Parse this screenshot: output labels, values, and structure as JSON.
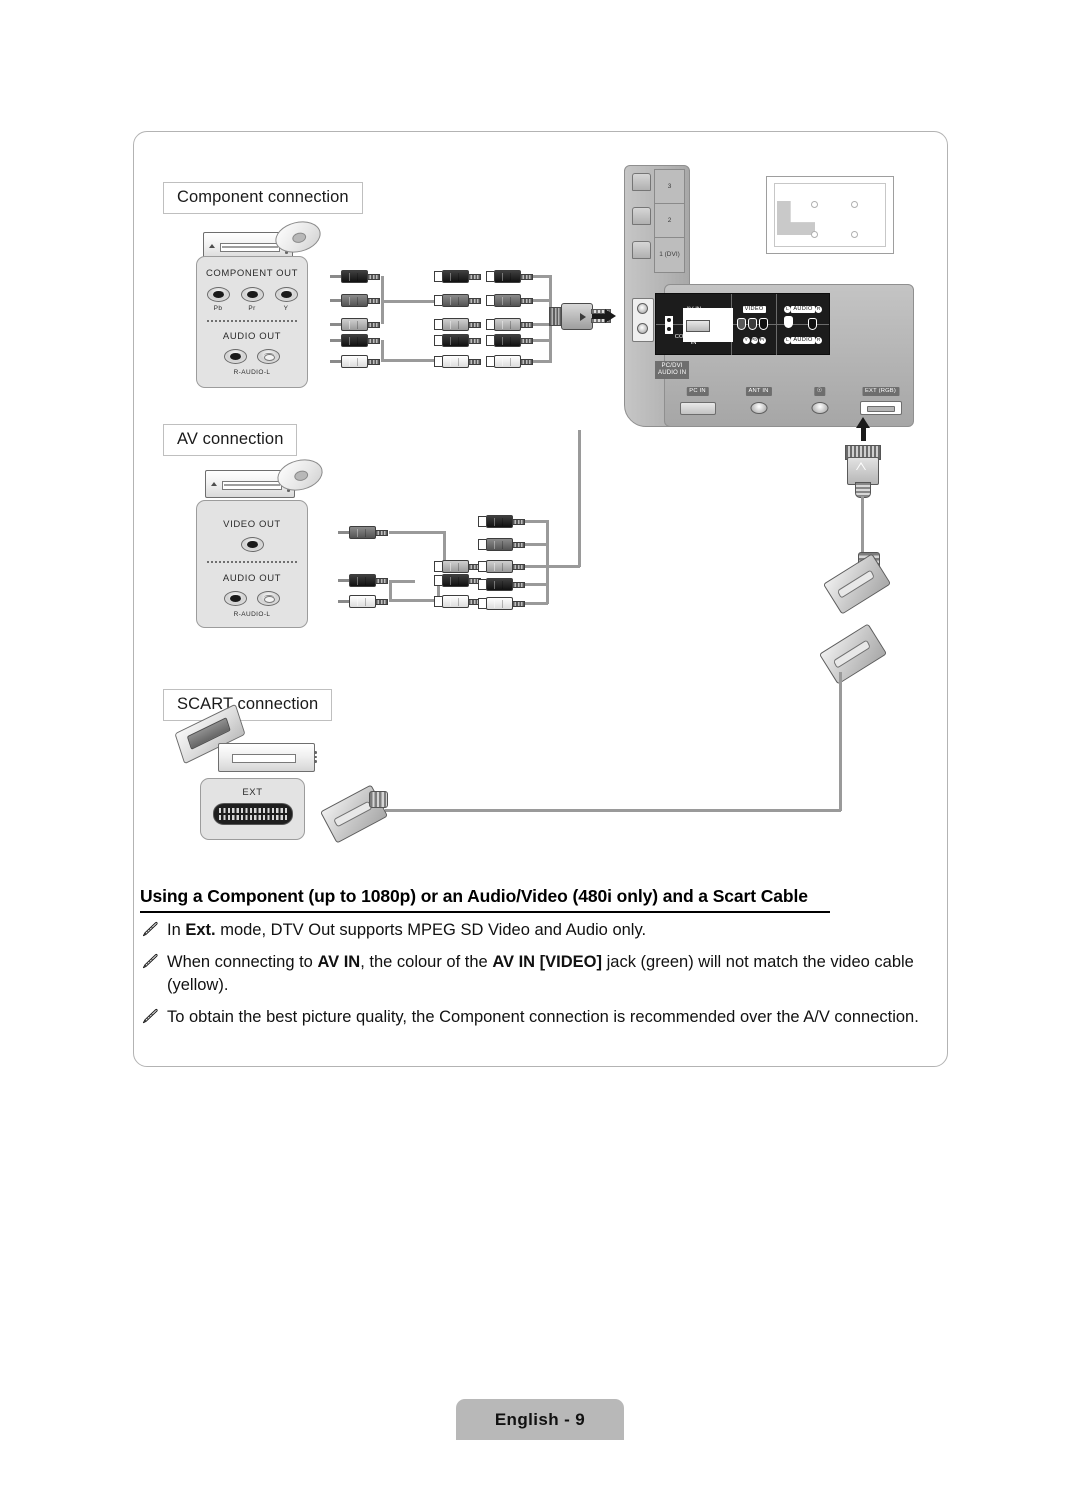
{
  "sections": [
    {
      "id": "component",
      "title": "Component connection"
    },
    {
      "id": "av",
      "title": "AV connection"
    },
    {
      "id": "scart",
      "title": "SCART connection"
    }
  ],
  "component_panel": {
    "out_label": "COMPONENT OUT",
    "jack_labels": [
      "Pb",
      "Pr",
      "Y"
    ],
    "audio_label": "AUDIO OUT",
    "audio_sub": "R-AUDIO-L"
  },
  "av_panel": {
    "video_label": "VIDEO OUT",
    "audio_label": "AUDIO OUT",
    "audio_sub": "R-AUDIO-L"
  },
  "scart_panel": {
    "ext_label": "EXT"
  },
  "tv_panel": {
    "hdmi_ports": [
      "3",
      "2",
      "1 (DVI)"
    ],
    "av_in_label": "AV IN",
    "video_label": "VIDEO",
    "audio_label_top": "AUDIO",
    "audio_left": "L",
    "audio_right": "R",
    "component_in_label": "COMPONENT\nIN",
    "component_pins": [
      "Y",
      "Pb",
      "Pr"
    ],
    "audio_label_bottom": "AUDIO",
    "pc_dvi_audio_in": "PC/DVI\nAUDIO IN",
    "bottom_ports": [
      "PC IN",
      "ANT IN",
      "☉",
      "EXT (RGB)"
    ]
  },
  "headline": "Using a Component (up to 1080p) or an Audio/Video (480i only) and a Scart Cable",
  "notes": [
    {
      "parts": [
        {
          "t": "In ",
          "b": false
        },
        {
          "t": "Ext.",
          "b": true
        },
        {
          "t": " mode, DTV Out supports MPEG SD Video and Audio only.",
          "b": false
        }
      ]
    },
    {
      "parts": [
        {
          "t": "When connecting to ",
          "b": false
        },
        {
          "t": "AV IN",
          "b": true
        },
        {
          "t": ", the colour of the ",
          "b": false
        },
        {
          "t": "AV IN [VIDEO]",
          "b": true
        },
        {
          "t": " jack (green) will not match the video cable (yellow).",
          "b": false
        }
      ]
    },
    {
      "parts": [
        {
          "t": "To obtain the best picture quality, the Component connection is recommended over the A/V connection.",
          "b": false
        }
      ]
    }
  ],
  "footer": {
    "page_label": "English - 9"
  },
  "colors": {
    "panel_border": "#b3b3b3",
    "jack_panel_bg": "#e3e3e3",
    "chassis": "#b5b5b5",
    "footer_bg": "#b8b8b8",
    "wire": "#9a9a9a"
  }
}
